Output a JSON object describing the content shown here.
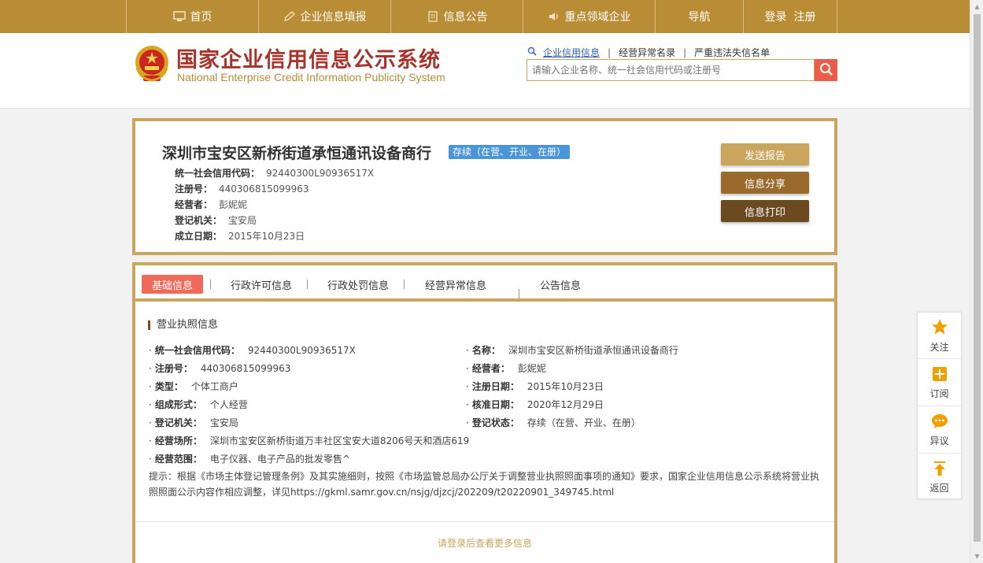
{
  "nav": {
    "items": [
      {
        "label": "首页",
        "icon": "monitor-icon"
      },
      {
        "label": "企业信息填报",
        "icon": "edit-icon"
      },
      {
        "label": "信息公告",
        "icon": "document-icon"
      },
      {
        "label": "重点领域企业",
        "icon": "speaker-icon"
      },
      {
        "label": "导航",
        "icon": ""
      },
      {
        "label": "登录  注册",
        "icon": ""
      }
    ]
  },
  "header": {
    "title_cn": "国家企业信用信息公示系统",
    "title_en": "National Enterprise Credit Information Publicity System",
    "search_links": [
      "企业信用信息",
      "经营异常名录",
      "严重违法失信名单"
    ],
    "search_placeholder": "请输入企业名称、统一社会信用代码或注册号"
  },
  "company": {
    "name": "深圳市宝安区新桥街道承恒通讯设备商行",
    "status": "存续（在营、开业、在册）",
    "rows": [
      {
        "label": "统一社会信用代码：",
        "value": "92440300L90936517X"
      },
      {
        "label": "注册号：",
        "value": "440306815099963"
      },
      {
        "label": "经营者：",
        "value": "彭妮妮"
      },
      {
        "label": "登记机关：",
        "value": "宝安局"
      },
      {
        "label": "成立日期：",
        "value": "2015年10月23日"
      }
    ],
    "buttons": [
      {
        "label": "发送报告",
        "color": "#c9a55e"
      },
      {
        "label": "信息分享",
        "color": "#9a6a2c"
      },
      {
        "label": "信息打印",
        "color": "#6b4a1f"
      }
    ]
  },
  "tabs": [
    "基础信息",
    "行政许可信息",
    "行政处罚信息",
    "经营异常信息",
    "公告信息"
  ],
  "license": {
    "section_title": "营业执照信息",
    "left": [
      {
        "label": "统一社会信用代码：",
        "value": "92440300L90936517X"
      },
      {
        "label": "注册号：",
        "value": "440306815099963"
      },
      {
        "label": "类型：",
        "value": "个体工商户"
      },
      {
        "label": "组成形式：",
        "value": "个人经营"
      },
      {
        "label": "登记机关：",
        "value": "宝安局"
      },
      {
        "label": "经营场所：",
        "value": "深圳市宝安区新桥街道万丰社区宝安大道8206号天和酒店619"
      },
      {
        "label": "经营范围：",
        "value": "电子仪器、电子产品的批发零售^"
      }
    ],
    "right": [
      {
        "label": "名称：",
        "value": "深圳市宝安区新桥街道承恒通讯设备商行"
      },
      {
        "label": "经营者：",
        "value": "彭妮妮"
      },
      {
        "label": "注册日期：",
        "value": "2015年10月23日"
      },
      {
        "label": "核准日期：",
        "value": "2020年12月29日"
      },
      {
        "label": "登记状态：",
        "value": "存续（在营、开业、在册）"
      }
    ],
    "notice": "提示：根据《市场主体登记管理条例》及其实施细则，按照《市场监管总局办公厅关于调整营业执照照面事项的通知》要求，国家企业信用信息公示系统将营业执照照面公示内容作相应调整，详见https://gkml.samr.gov.cn/nsjg/djzcj/202209/t20220901_349745.html",
    "login_more": "请登录后查看更多信息"
  },
  "float_bar": [
    {
      "label": "关注",
      "icon": "star-icon"
    },
    {
      "label": "订阅",
      "icon": "plus-icon"
    },
    {
      "label": "异议",
      "icon": "chat-icon"
    },
    {
      "label": "返回",
      "icon": "arrow-up-icon"
    }
  ],
  "colors": {
    "gold": "#b88d35",
    "border_gold": "#c9a55e",
    "red": "#a8342b",
    "active_tab": "#f06a5a",
    "status_blue": "#4b94d8",
    "float_icon": "#f0a000"
  }
}
